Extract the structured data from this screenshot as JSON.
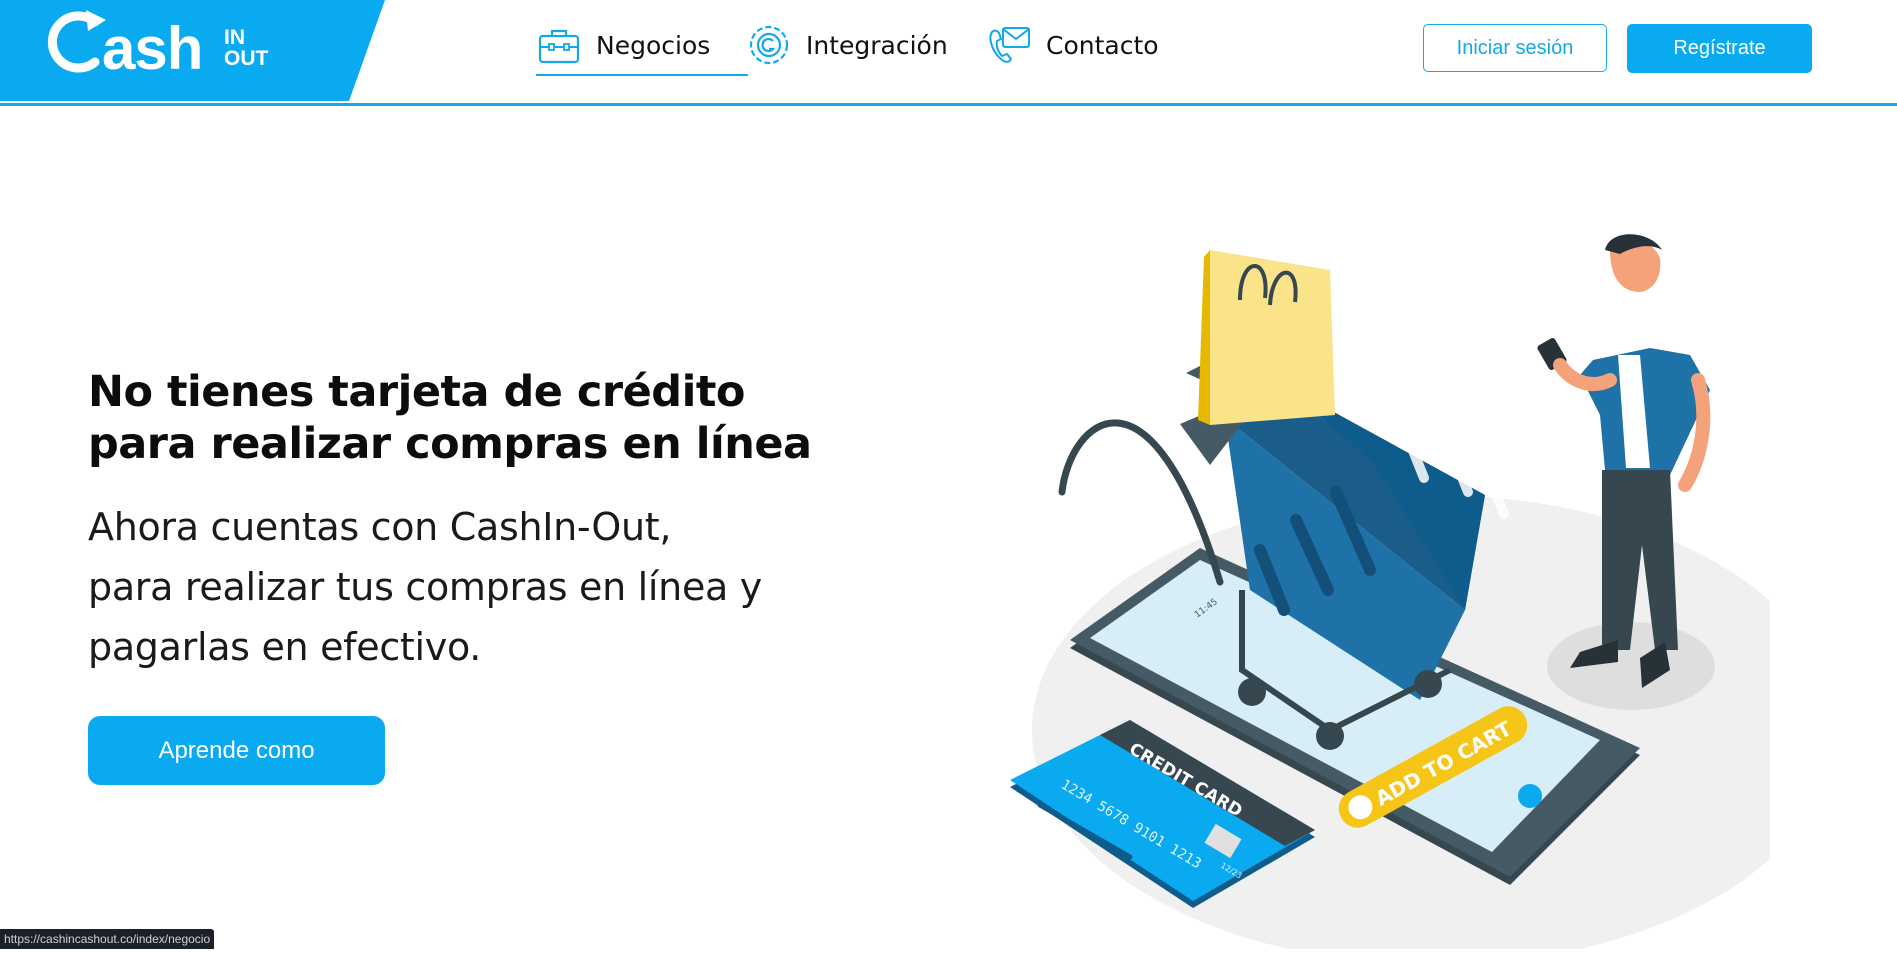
{
  "brand": {
    "word": "ash",
    "in": "IN",
    "out": "OUT",
    "primary_color": "#12a8ec"
  },
  "nav": {
    "items": [
      {
        "label": "Negocios",
        "icon": "briefcase-icon"
      },
      {
        "label": "Integración",
        "icon": "gear-integration-icon"
      },
      {
        "label": "Contacto",
        "icon": "mail-phone-icon"
      }
    ]
  },
  "auth": {
    "login_label": "Iniciar sesión",
    "register_label": "Regístrate"
  },
  "hero": {
    "title_line1": "No tienes tarjeta de crédito",
    "title_line2": "para realizar compras en línea",
    "sub_line1": "Ahora cuentas con CashIn-Out,",
    "sub_line2": "para realizar tus compras en línea y",
    "sub_line3": "pagarlas en efectivo.",
    "cta_label": "Aprende como"
  },
  "illustration": {
    "card_title": "CREDIT CARD",
    "card_number": "1234  5678  9101  1213",
    "card_expiry": "12/23",
    "cart_button": "ADD TO CART",
    "phone_time": "11:45"
  },
  "status_bar": {
    "url": "https://cashincashout.co/index/negocio"
  }
}
